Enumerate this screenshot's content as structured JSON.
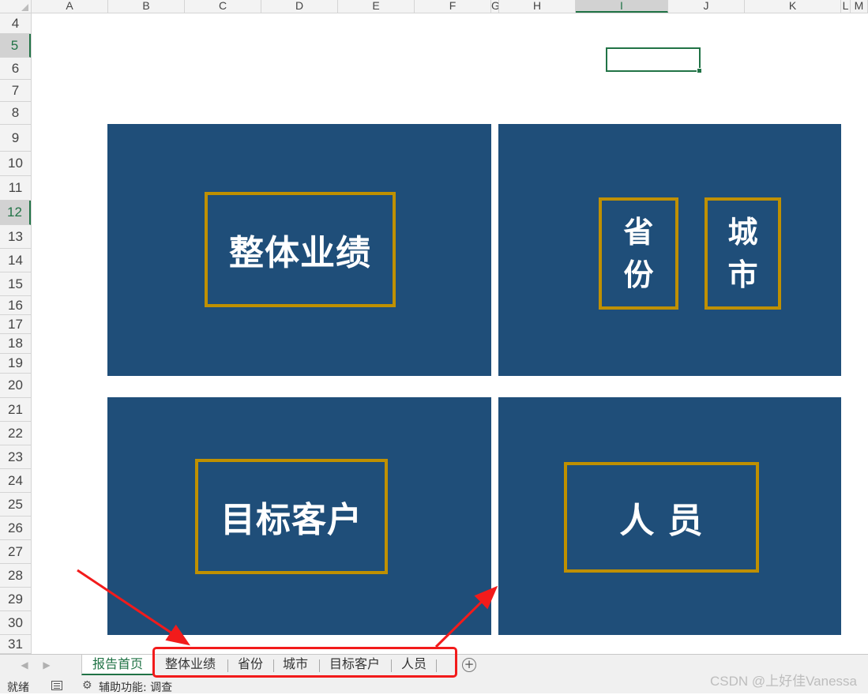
{
  "columns": [
    "A",
    "B",
    "C",
    "D",
    "E",
    "F",
    "G",
    "H",
    "I",
    "J",
    "K",
    "L",
    "M"
  ],
  "selected_column": "I",
  "rows": [
    "4",
    "5",
    "6",
    "7",
    "8",
    "9",
    "10",
    "11",
    "12",
    "13",
    "14",
    "15",
    "16",
    "17",
    "18",
    "19",
    "20",
    "21",
    "22",
    "23",
    "24",
    "25",
    "26",
    "27",
    "28",
    "29",
    "30",
    "31"
  ],
  "selected_rows": [
    "5",
    "12"
  ],
  "tiles": {
    "overall": {
      "label": "整体业绩"
    },
    "province": {
      "label_lines": [
        "省",
        "份"
      ]
    },
    "city": {
      "label_lines": [
        "城",
        "市"
      ]
    },
    "target": {
      "label": "目标客户"
    },
    "people": {
      "label": "人 员"
    }
  },
  "sheet_tabs": [
    "报告首页",
    "整体业绩",
    "省份",
    "城市",
    "目标客户",
    "人员"
  ],
  "active_tab": "报告首页",
  "status": {
    "ready": "就绪",
    "accessibility": "辅助功能: 调查"
  },
  "watermark": "CSDN @上好佳Vanessa",
  "colors": {
    "tile_bg": "#1f4e79",
    "gold_border": "#bf9000",
    "excel_green": "#217346",
    "annotation_red": "#f21b1b"
  }
}
